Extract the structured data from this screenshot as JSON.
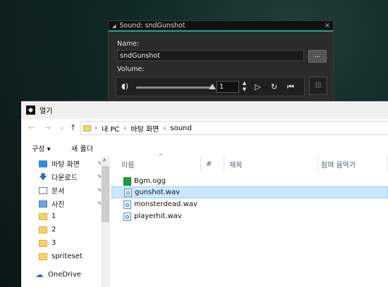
{
  "sound_editor": {
    "title": "Sound: sndGunshot",
    "close_label": "×",
    "name_label": "Name:",
    "name_value": "sndGunshot",
    "browse_label": "...",
    "volume_label": "Volume:",
    "volume_value": "1",
    "volume_level": 1.0,
    "icons": [
      "speaker-icon",
      "play-icon",
      "loop-icon",
      "stop-icon",
      "mixer-icon"
    ],
    "accent": "#1fae86"
  },
  "open_dialog": {
    "title": "열기",
    "breadcrumb": [
      "내 PC",
      "바탕 화면",
      "sound"
    ],
    "toolbar": {
      "organize": "구성 ▾",
      "new_folder": "새 폴더"
    },
    "nav_items": [
      {
        "label": "바탕 화면",
        "icon": "desktop-icon",
        "pinned": true
      },
      {
        "label": "다운로드",
        "icon": "download-icon",
        "pinned": true
      },
      {
        "label": "문서",
        "icon": "document-icon",
        "pinned": true
      },
      {
        "label": "사진",
        "icon": "pictures-icon",
        "pinned": true
      },
      {
        "label": "1",
        "icon": "folder-icon",
        "pinned": false
      },
      {
        "label": "2",
        "icon": "folder-icon",
        "pinned": false
      },
      {
        "label": "3",
        "icon": "folder-icon",
        "pinned": false
      },
      {
        "label": "spriteset",
        "icon": "folder-icon",
        "pinned": false
      },
      {
        "label": "OneDrive",
        "icon": "onedrive-icon",
        "pinned": false
      }
    ],
    "columns": [
      "이름",
      "#",
      "제목",
      "참여 음악가"
    ],
    "files": [
      {
        "name": "Bgm.ogg",
        "icon": "ogg-file-icon",
        "selected": false
      },
      {
        "name": "gunshot.wav",
        "icon": "wav-file-icon",
        "selected": true
      },
      {
        "name": "monsterdead.wav",
        "icon": "wav-file-icon",
        "selected": false
      },
      {
        "name": "playerhit.wav",
        "icon": "wav-file-icon",
        "selected": false
      }
    ]
  }
}
